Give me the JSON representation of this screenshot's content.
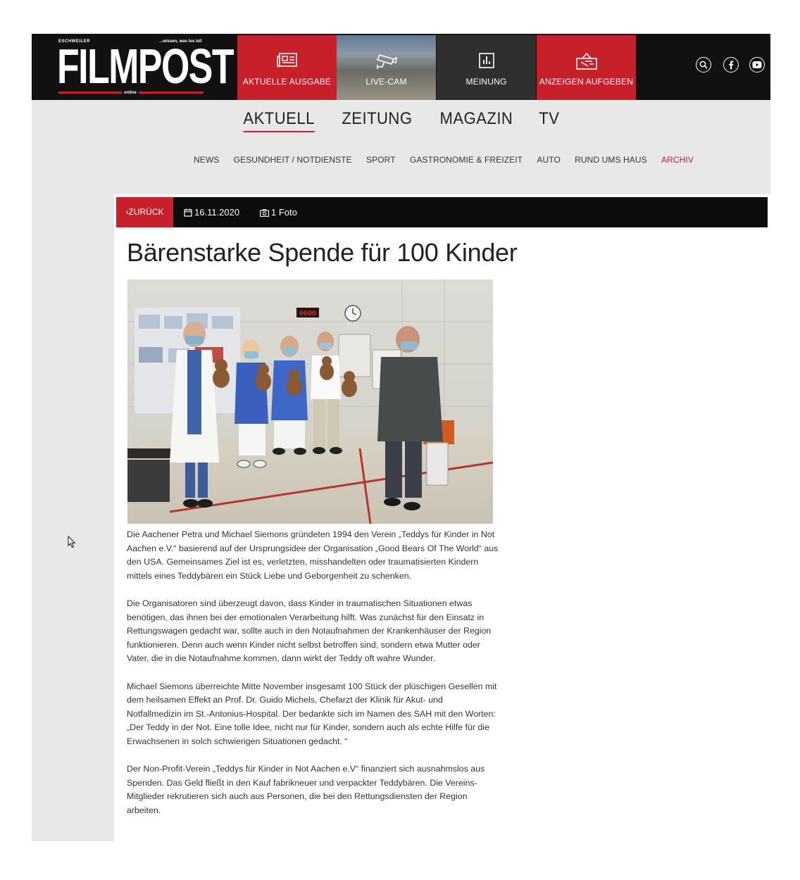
{
  "logo": {
    "kicker_left": "ESCHWEILER",
    "kicker_right": "...wissen, was los ist!",
    "wordmark": "FILMPOST",
    "sub": "online"
  },
  "header_tiles": [
    {
      "label": "AKTUELLE AUSGABE",
      "icon": "newspaper-icon"
    },
    {
      "label": "LIVE-CAM",
      "icon": "security-camera-icon"
    },
    {
      "label": "MEINUNG",
      "icon": "bar-chart-icon"
    },
    {
      "label": "ANZEIGEN AUFGEBEN",
      "icon": "ad-sign-icon"
    }
  ],
  "social_icons": [
    "search-icon",
    "facebook-icon",
    "youtube-icon"
  ],
  "main_nav": [
    {
      "label": "AKTUELL",
      "active": true
    },
    {
      "label": "ZEITUNG",
      "active": false
    },
    {
      "label": "MAGAZIN",
      "active": false
    },
    {
      "label": "TV",
      "active": false
    }
  ],
  "sub_nav": [
    {
      "label": "NEWS"
    },
    {
      "label": "GESUNDHEIT / NOTDIENSTE"
    },
    {
      "label": "SPORT"
    },
    {
      "label": "GASTRONOMIE & FREIZEIT"
    },
    {
      "label": "AUTO"
    },
    {
      "label": "RUND UMS HAUS"
    },
    {
      "label": "ARCHIV"
    }
  ],
  "article_bar": {
    "back_label": "ZURÜCK",
    "date": "16.11.2020",
    "photos": "1 Foto"
  },
  "article": {
    "headline": "Bärenstarke Spende für 100 Kinder",
    "clock_display": "0000",
    "paragraphs": [
      "Die Aachener Petra und Michael Siemons gründeten 1994 den Verein „Teddys für Kinder in Not Aachen e.V.“ basierend auf der Ursprungsidee der Organisation „Good Bears Of The World“ aus den USA. Gemeinsames Ziel ist es, verletzten, misshandelten oder traumatisierten Kindern mittels eines Teddybären ein Stück Liebe und Geborgenheit zu schenken.",
      "Die Organisatoren sind überzeugt davon, dass Kinder in traumatischen Situationen etwas benötigen, das ihnen bei der emotionalen Verarbeitung hilft. Was zunächst für den Einsatz in Rettungswagen gedacht war, sollte auch in den Notaufnahmen der Krankenhäuser der Region funktionieren. Denn auch wenn Kinder nicht selbst betroffen sind, sondern etwa Mutter oder Vater, die in die Notaufnahme kommen, dann wirkt der Teddy oft wahre Wunder.",
      "Michael Siemons überreichte Mitte November insgesamt 100 Stück der plüschigen Gesellen mit dem heilsamen Effekt an Prof. Dr. Guido Michels, Chefarzt der Klinik für Akut- und Notfallmedizin im St.-Antonius-Hospital. Der bedankte sich im Namen des SAH mit den Worten: „Der Teddy in der Not. Eine tolle Idee, nicht nur für Kinder, sondern auch als echte Hilfe für die Erwachsenen in solch schwierigen Situationen gedacht. “",
      "Der Non-Profit-Verein „Teddys für Kinder in Not Aachen e.V“ finanziert sich ausnahmslos aus Spenden. Das Geld fließt in den Kauf fabrikneuer und verpackter Teddybären. Die Vereins-Mitglieder rekrutieren sich auch aus Personen, die bei den Rettungsdiensten der Region arbeiten."
    ]
  },
  "colors": {
    "brand_red": "#c8202a",
    "header_black": "#111111",
    "page_grey": "#e8e8e8"
  }
}
